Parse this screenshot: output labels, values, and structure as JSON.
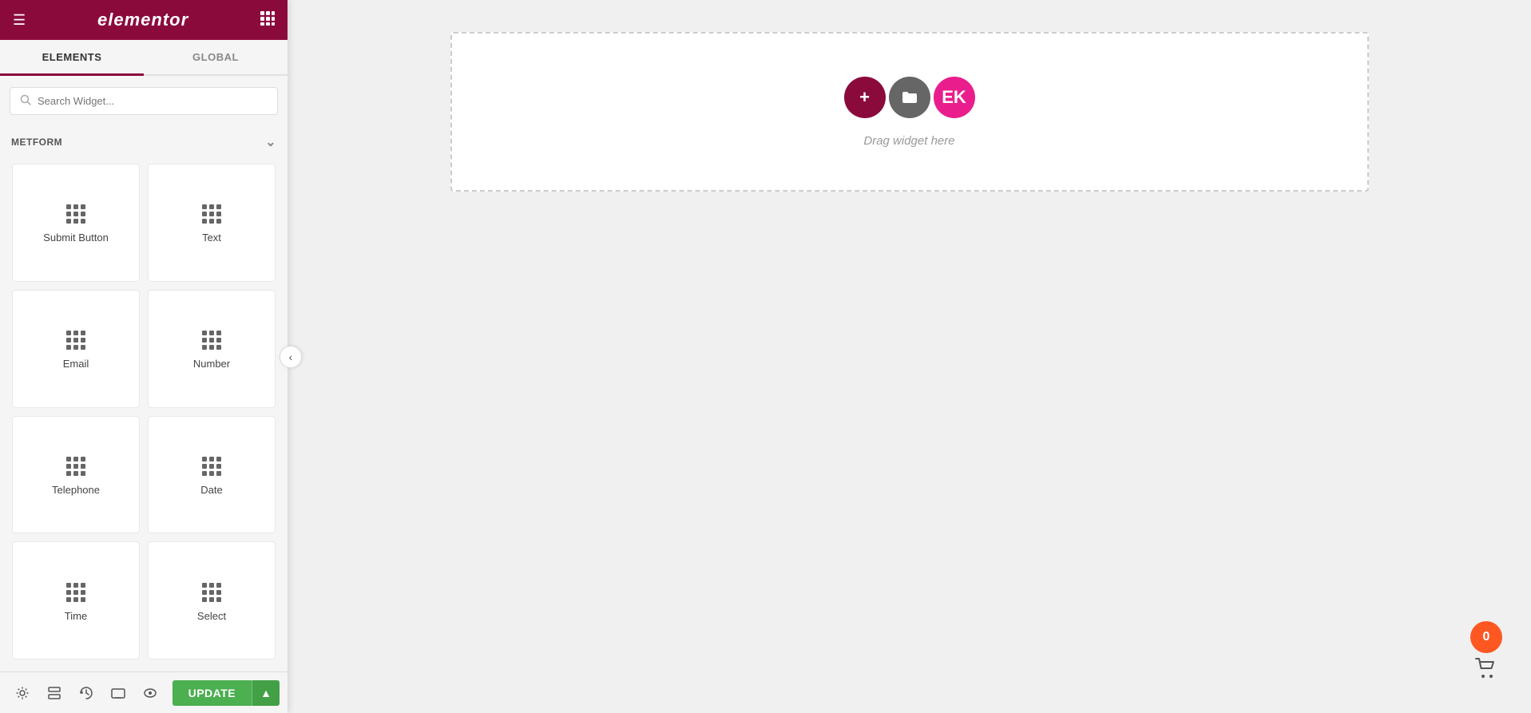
{
  "header": {
    "logo": "elementor",
    "hamburger": "☰",
    "grid": "⊞"
  },
  "tabs": [
    {
      "id": "elements",
      "label": "ELEMENTS",
      "active": true
    },
    {
      "id": "global",
      "label": "GLOBAL",
      "active": false
    }
  ],
  "search": {
    "placeholder": "Search Widget..."
  },
  "section": {
    "label": "METFORM",
    "chevron": "⌄"
  },
  "widgets": [
    {
      "id": "submit-button",
      "label": "Submit Button"
    },
    {
      "id": "text",
      "label": "Text"
    },
    {
      "id": "email",
      "label": "Email"
    },
    {
      "id": "number",
      "label": "Number"
    },
    {
      "id": "telephone",
      "label": "Telephone"
    },
    {
      "id": "date",
      "label": "Date"
    },
    {
      "id": "time",
      "label": "Time"
    },
    {
      "id": "select",
      "label": "Select"
    }
  ],
  "toolbar": {
    "settings_icon": "⚙",
    "layers_icon": "◫",
    "history_icon": "↺",
    "responsive_icon": "☐",
    "preview_icon": "👁",
    "update_label": "UPDATE",
    "arrow_label": "▲"
  },
  "canvas": {
    "drag_hint": "Drag widget here",
    "add_btn": "+",
    "folder_btn": "🗀",
    "ek_btn": "EK"
  },
  "cart": {
    "count": "0"
  }
}
